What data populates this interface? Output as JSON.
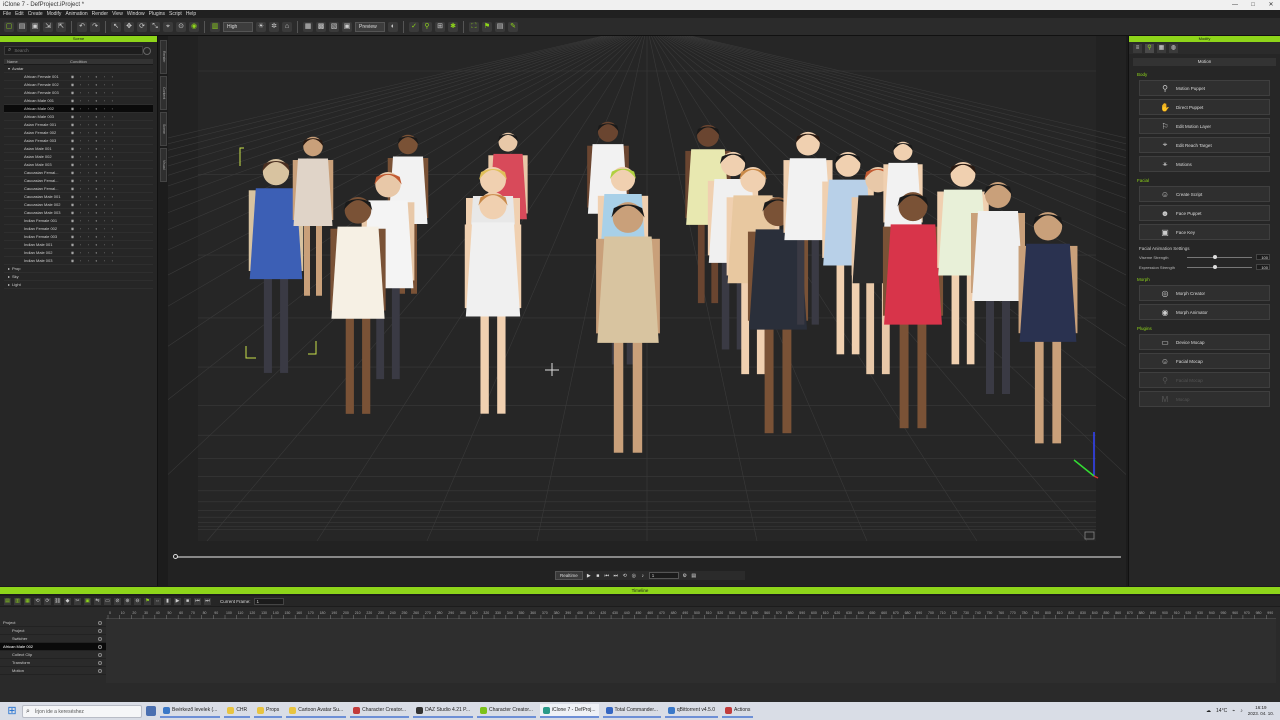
{
  "window": {
    "title": "iClone 7 - DefProject.iProject *",
    "controls": [
      "—",
      "□",
      "✕"
    ]
  },
  "menu": [
    "File",
    "Edit",
    "Create",
    "Modify",
    "Animation",
    "Render",
    "View",
    "Window",
    "Plugins",
    "Script",
    "Help"
  ],
  "toolbar": {
    "quality": "High",
    "preview": "Preview"
  },
  "scene": {
    "title": "Scene",
    "search_placeholder": "Search",
    "col_name": "Name",
    "col_condition": "Condition",
    "avatar_group": "Avatar",
    "items": [
      "African Female 001",
      "African Female 002",
      "African Female 003",
      "African Male 001",
      "African Male 002",
      "African Male 003",
      "Asian Female 001",
      "Asian Female 002",
      "Asian Female 003",
      "Asian Male 001",
      "Asian Male 002",
      "Asian Male 003",
      "Caucasian Femal...",
      "Caucasian Femal...",
      "Caucasian Femal...",
      "Caucasian Male 001",
      "Caucasian Male 002",
      "Caucasian Male 003",
      "Indian Female 001",
      "Indian Female 002",
      "Indian Female 003",
      "Indian Male 001",
      "Indian Male 002",
      "Indian Male 003"
    ],
    "selected_index": 4,
    "groups": [
      "Prop",
      "Sky",
      "Light"
    ],
    "side_tabs": [
      "Render",
      "Content",
      "Scene",
      "Visual"
    ]
  },
  "playback": {
    "mode": "Realtime",
    "frame": "1"
  },
  "modify": {
    "title": "Modify",
    "header": "Motion",
    "sections": {
      "body": "Body",
      "facial": "Facial",
      "morph": "Morph",
      "plugins": "Plugins"
    },
    "body_buttons": [
      "Motion Puppet",
      "Direct Puppet",
      "Edit Motion Layer",
      "Edit Reach Target",
      "Motions"
    ],
    "facial_buttons": [
      "Create Script",
      "Face Puppet",
      "Face Key"
    ],
    "facial_settings": "Facial Animation Settings",
    "viseme_label": "Viseme Strength",
    "viseme_value": "100",
    "viseme_fraction": 0.4,
    "expression_label": "Expression Strength",
    "expression_value": "100",
    "expression_fraction": 0.4,
    "morph_buttons": [
      "Morph Creator",
      "Morph Animator"
    ],
    "plugin_buttons": [
      "Device Mocap",
      "Facial Mocap"
    ],
    "plugin_buttons_disabled": [
      "Facial Mocap",
      "Mocap"
    ]
  },
  "timeline": {
    "title": "Timeline",
    "current_frame_label": "Current Frame:",
    "current_frame_value": "1",
    "tracks": [
      "Project",
      "Project",
      "Switcher",
      "African Male 002",
      "Collect Clip",
      "Transform",
      "Motion"
    ],
    "selected_track": 3,
    "ruler": [
      "0",
      "10",
      "20",
      "30",
      "40",
      "50",
      "60",
      "70",
      "80",
      "90",
      "100",
      "110",
      "120",
      "130",
      "140",
      "150",
      "160",
      "170",
      "180",
      "190",
      "200",
      "210",
      "220",
      "230",
      "240",
      "250",
      "260",
      "270",
      "280",
      "290",
      "300",
      "310",
      "320",
      "330",
      "340",
      "350",
      "360",
      "370",
      "380",
      "390",
      "400",
      "410",
      "420",
      "430",
      "440",
      "450",
      "460",
      "470",
      "480",
      "490",
      "500",
      "510",
      "520",
      "530",
      "540",
      "550",
      "560",
      "570",
      "580",
      "590",
      "600",
      "610",
      "620",
      "630",
      "640",
      "650",
      "660",
      "670",
      "680",
      "690",
      "700",
      "710",
      "720",
      "730",
      "740",
      "750",
      "760",
      "770",
      "780",
      "790",
      "800",
      "810",
      "820",
      "830",
      "840",
      "850",
      "860",
      "870",
      "880",
      "890",
      "900",
      "910",
      "920",
      "930",
      "940",
      "950",
      "960",
      "970",
      "980",
      "990",
      "1000"
    ]
  },
  "taskbar": {
    "search_placeholder": "Írjon ide a kereséshez",
    "apps": [
      "Beérkező levelek (...",
      "CHR",
      "Props",
      "Cartoon Avatar Su...",
      "Character Creator...",
      "DAZ Studio 4.21 P...",
      "Character Creator...",
      "iClone 7 - DefProj...",
      "Total Commander...",
      "qBittorrent v4.5.0",
      "Actions"
    ],
    "weather": "14°C",
    "time": "16:19",
    "date": "2023. 04. 10."
  },
  "colors": {
    "accent": "#8ed51a",
    "panel": "#262626",
    "viewport": "#222222"
  }
}
